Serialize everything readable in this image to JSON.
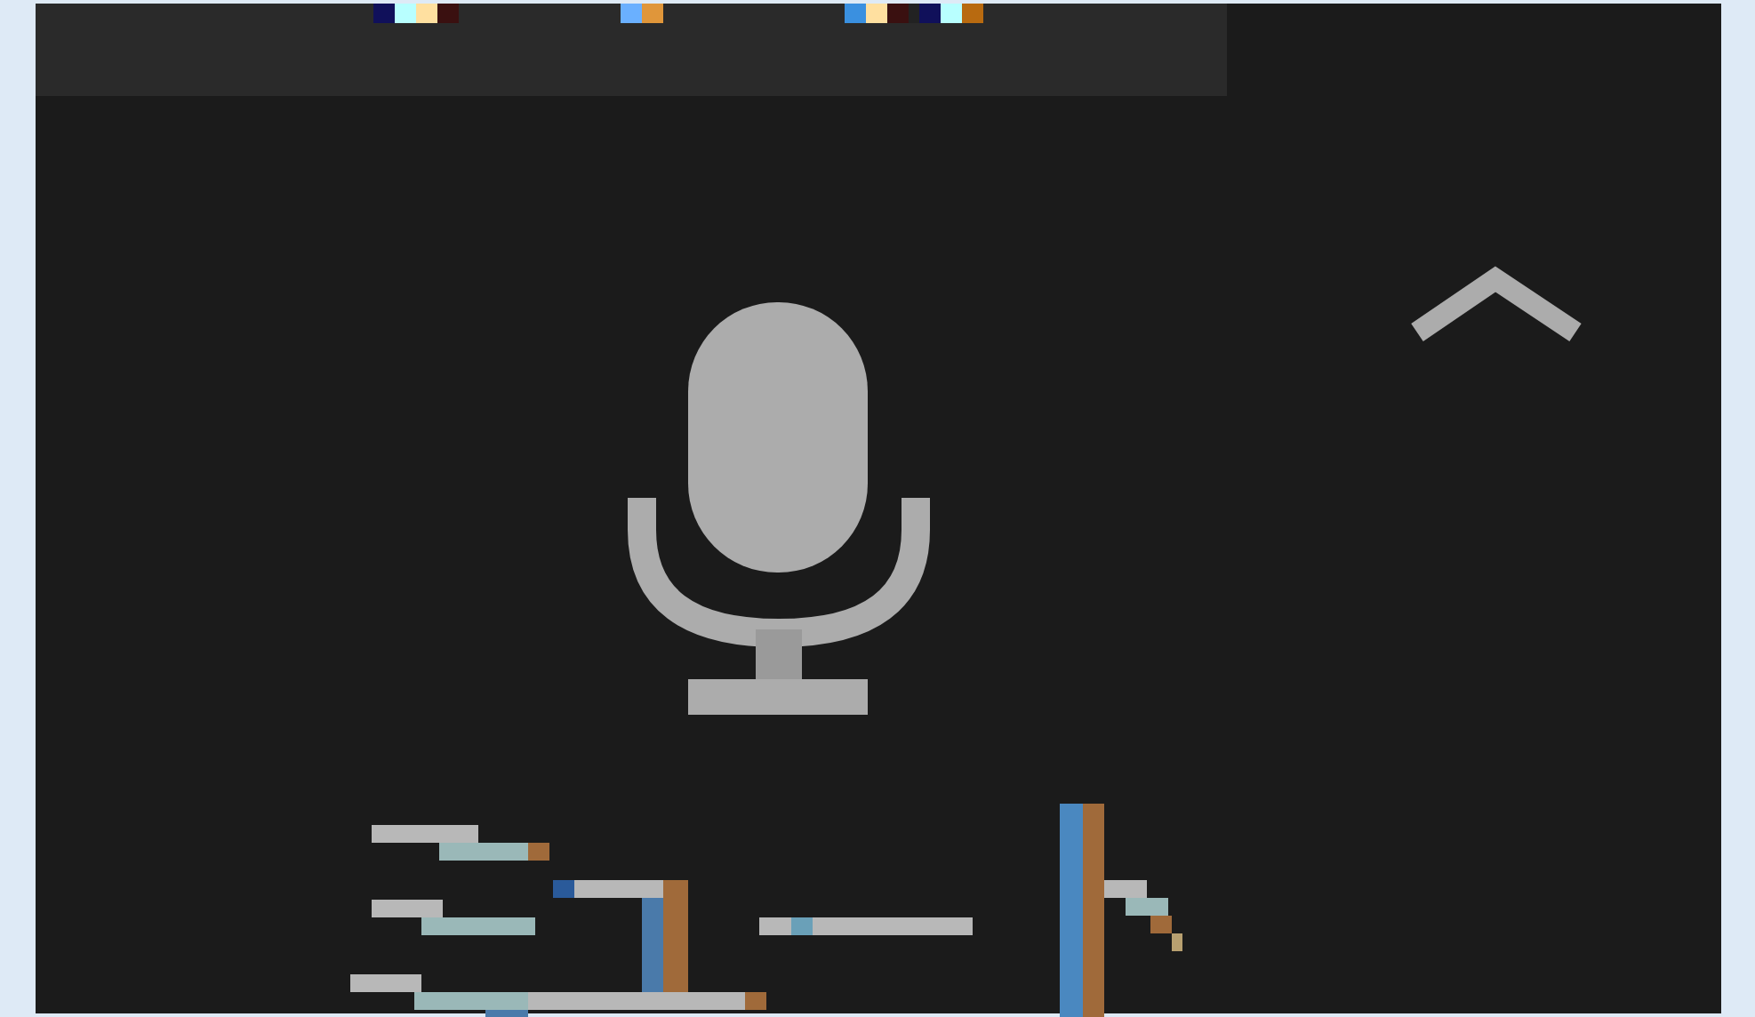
{
  "toolbar": {
    "kind": "color-strip"
  },
  "icons": [
    {
      "kind": "microphone"
    },
    {
      "kind": "caret-up"
    },
    {
      "kind": "glyph-strip"
    }
  ]
}
